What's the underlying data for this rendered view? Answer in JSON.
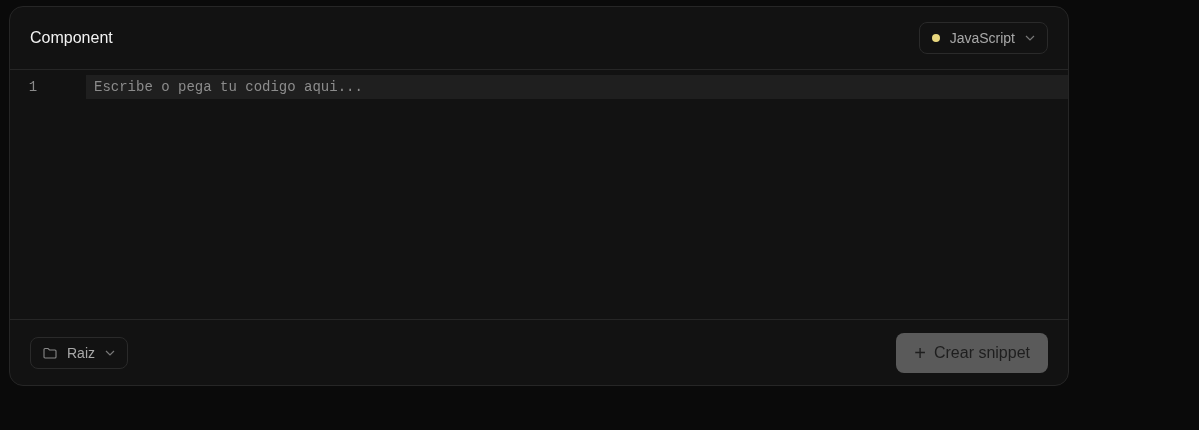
{
  "card": {
    "title": "Component"
  },
  "language_select": {
    "value": "JavaScript",
    "color": "#e8d77e"
  },
  "editor": {
    "line_numbers": [
      "1"
    ],
    "placeholder": "Escribe o pega tu codigo aqui..."
  },
  "folder_select": {
    "value": "Raiz"
  },
  "create_button": {
    "icon": "+",
    "label": "Crear snippet",
    "disabled": true
  }
}
